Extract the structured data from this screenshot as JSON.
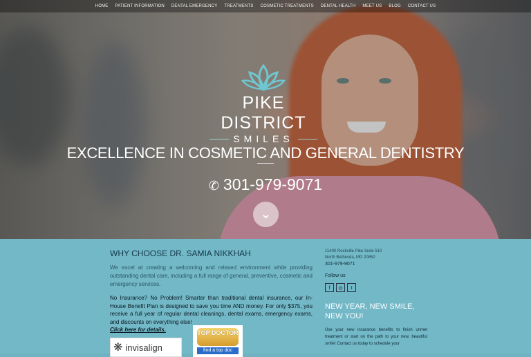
{
  "nav": [
    "HOME",
    "PATIENT INFORMATION",
    "DENTAL EMERGENCY",
    "TREATMENTS",
    "COSMETIC TREATMENTS",
    "DENTAL HEALTH",
    "MEET US",
    "BLOG",
    "CONTACT US"
  ],
  "logo": {
    "line1": "PIKE DISTRICT",
    "line2": "SMILES"
  },
  "hero": {
    "tagline": "EXCELLENCE IN COSMETIC AND GENERAL DENTISTRY",
    "phone": "301-979-9071"
  },
  "left": {
    "heading": "WHY CHOOSE DR. SAMIA NIKKHAH",
    "intro": "We excel at creating a welcoming and relaxed environment while providing outstanding dental care, including a full range of general, preventive, cosmetic and emergency services.",
    "insurance": "No Insurance?  No Problem!  Smarter than traditional dental insurance, our In-House Benefit Plan is designed to save you time AND money.  For only $375, you receive a full year of regular dental cleanings, dental exams, emergency exams, and discounts on everything else!",
    "link": "Click here for details.",
    "badge1": "invisalign",
    "badge2_top": "TOP DOCTOR",
    "badge2_bottom": "find a top doc"
  },
  "right": {
    "address1": "11400 Rockville Pike Suite 510",
    "address2": "North Bethesda, MD 20852",
    "phone": "301-979-9071",
    "follow": "Follow us",
    "social": [
      "f",
      "◎",
      "t"
    ],
    "heading": "NEW YEAR, NEW SMILE, NEW YOU!",
    "text": "Use your new insurance benefits to finish unmet treatment or start on the path to your new, beautiful smile!  Contact us today to schedule your"
  }
}
